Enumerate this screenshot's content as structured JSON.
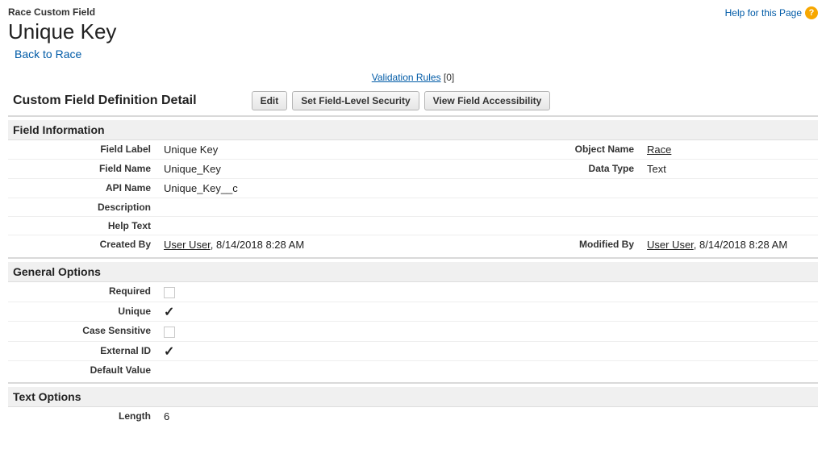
{
  "header": {
    "object_type": "Race Custom Field",
    "page_title": "Unique Key",
    "back_link": "Back to Race",
    "help_text": "Help for this Page"
  },
  "validation": {
    "link_text": "Validation Rules",
    "count": "[0]"
  },
  "detail": {
    "title": "Custom Field Definition Detail",
    "buttons": {
      "edit": "Edit",
      "fls": "Set Field-Level Security",
      "vfa": "View Field Accessibility"
    }
  },
  "sections": {
    "field_info": {
      "heading": "Field Information",
      "field_label_lbl": "Field Label",
      "field_label_val": "Unique Key",
      "object_name_lbl": "Object Name",
      "object_name_val": "Race",
      "field_name_lbl": "Field Name",
      "field_name_val": "Unique_Key",
      "data_type_lbl": "Data Type",
      "data_type_val": "Text",
      "api_name_lbl": "API Name",
      "api_name_val": "Unique_Key__c",
      "description_lbl": "Description",
      "help_text_lbl": "Help Text",
      "created_by_lbl": "Created By",
      "created_by_user": "User User",
      "created_by_rest": ", 8/14/2018 8:28 AM",
      "modified_by_lbl": "Modified By",
      "modified_by_user": "User User",
      "modified_by_rest": ", 8/14/2018 8:28 AM"
    },
    "general": {
      "heading": "General Options",
      "required_lbl": "Required",
      "required_checked": false,
      "unique_lbl": "Unique",
      "unique_checked": true,
      "case_sensitive_lbl": "Case Sensitive",
      "case_sensitive_checked": false,
      "external_id_lbl": "External ID",
      "external_id_checked": true,
      "default_value_lbl": "Default Value"
    },
    "text": {
      "heading": "Text Options",
      "length_lbl": "Length",
      "length_val": "6"
    }
  }
}
